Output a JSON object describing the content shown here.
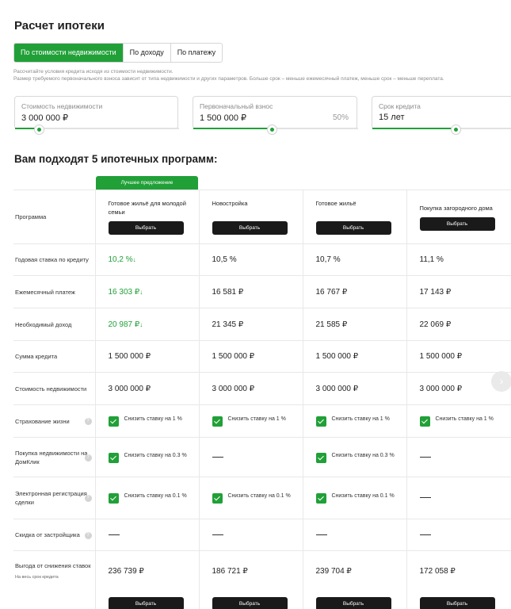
{
  "title": "Расчет ипотеки",
  "tabs": [
    {
      "label": "По стоимости недвижимости",
      "active": true
    },
    {
      "label": "По доходу",
      "active": false
    },
    {
      "label": "По платежу",
      "active": false
    }
  ],
  "description": [
    "Рассчитайте условия кредита исходя из стоимости недвижимости.",
    "Размер требуемого первоначального взноса зависит от типа недвижимости и других параметров. Больше срок – меньше ежемесячный платеж, меньше срок – меньше переплата."
  ],
  "fields": {
    "price": {
      "label": "Стоимость недвижимости",
      "value": "3 000 000 ₽",
      "slider": 0.15
    },
    "down_payment": {
      "label": "Первоначальный взнос",
      "value": "1 500 000 ₽",
      "percent": "50%",
      "slider": 0.48
    },
    "term": {
      "label": "Срок кредита",
      "value": "15 лет",
      "slider": 0.6
    }
  },
  "programs_heading": "Вам подходят 5 ипотечных программ:",
  "best_offer": "Лучшее предложение",
  "row_labels": {
    "program": "Программа",
    "rate": "Годовая ставка по кредиту",
    "payment": "Ежемесячный платеж",
    "income": "Необходимый доход",
    "loan": "Сумма кредита",
    "price": "Стоимость недвижимости",
    "insurance": "Страхование жизни",
    "domclick": "Покупка недвижимости на ДомКлик",
    "e_reg": "Электронная регистрация сделки",
    "developer": "Скидка от застройщика",
    "savings": "Выгода от снижения ставок",
    "savings_sub": "На весь срок кредита"
  },
  "select_label": "Выбрать",
  "programs": [
    {
      "name": "Готовое жильё для молодой семьи",
      "rate": "10,2 %",
      "payment": "16 303 ₽",
      "income": "20 987 ₽",
      "loan": "1 500 000 ₽",
      "price": "3 000 000 ₽",
      "insurance": "Снизить ставку на 1 %",
      "domclick": "Снизить ставку на 0.3 %",
      "e_reg": "Снизить ставку на 0.1 %",
      "developer": "",
      "savings": "236 739 ₽"
    },
    {
      "name": "Новостройка",
      "rate": "10,5 %",
      "payment": "16 581 ₽",
      "income": "21 345 ₽",
      "loan": "1 500 000 ₽",
      "price": "3 000 000 ₽",
      "insurance": "Снизить ставку на 1 %",
      "domclick": "",
      "e_reg": "Снизить ставку на 0.1 %",
      "developer": "",
      "savings": "186 721 ₽"
    },
    {
      "name": "Готовое жильё",
      "rate": "10,7 %",
      "payment": "16 767 ₽",
      "income": "21 585 ₽",
      "loan": "1 500 000 ₽",
      "price": "3 000 000 ₽",
      "insurance": "Снизить ставку на 1 %",
      "domclick": "Снизить ставку на 0.3 %",
      "e_reg": "Снизить ставку на 0.1 %",
      "developer": "",
      "savings": "239 704 ₽"
    },
    {
      "name": "Покупка загородного дома",
      "rate": "11,1 %",
      "payment": "17 143 ₽",
      "income": "22 069 ₽",
      "loan": "1 500 000 ₽",
      "price": "3 000 000 ₽",
      "insurance": "Снизить ставку на 1 %",
      "domclick": "",
      "e_reg": "",
      "developer": "",
      "savings": "172 058 ₽"
    }
  ]
}
